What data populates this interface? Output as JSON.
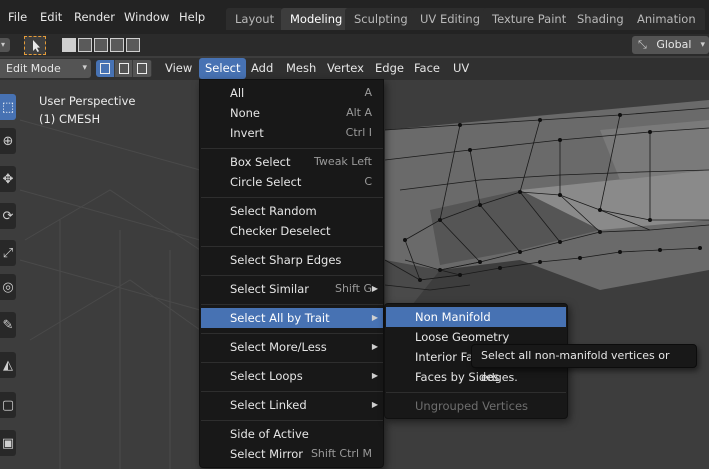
{
  "topbar": {
    "menus": [
      "File",
      "Edit",
      "Render",
      "Window",
      "Help"
    ],
    "workspaces": [
      "Layout",
      "Modeling",
      "Sculpting",
      "UV Editing",
      "Texture Paint",
      "Shading",
      "Animation"
    ],
    "active_workspace": "Modeling"
  },
  "toolrow": {
    "transform_orientation": "Global"
  },
  "header2": {
    "mode": "Edit Mode",
    "menus": [
      "View",
      "Select",
      "Add",
      "Mesh",
      "Vertex",
      "Edge",
      "Face",
      "UV"
    ],
    "active_menu": "Select"
  },
  "viewport": {
    "perspective": "User Perspective",
    "object": "(1) CMESH"
  },
  "select_menu": {
    "items": [
      {
        "label": "All",
        "shortcut": "A"
      },
      {
        "label": "None",
        "shortcut": "Alt A"
      },
      {
        "label": "Invert",
        "shortcut": "Ctrl I"
      },
      {
        "label": "Box Select",
        "shortcut": "Tweak Left"
      },
      {
        "label": "Circle Select",
        "shortcut": "C"
      },
      {
        "label": "Select Random",
        "shortcut": ""
      },
      {
        "label": "Checker Deselect",
        "shortcut": ""
      },
      {
        "label": "Select Sharp Edges",
        "shortcut": ""
      },
      {
        "label": "Select Similar",
        "shortcut": "Shift G"
      },
      {
        "label": "Select All by Trait",
        "shortcut": ""
      },
      {
        "label": "Select More/Less",
        "shortcut": ""
      },
      {
        "label": "Select Loops",
        "shortcut": ""
      },
      {
        "label": "Select Linked",
        "shortcut": ""
      },
      {
        "label": "Side of Active",
        "shortcut": ""
      },
      {
        "label": "Select Mirror",
        "shortcut": "Shift Ctrl M"
      }
    ],
    "highlighted": "Select All by Trait"
  },
  "trait_submenu": {
    "items": [
      "Non Manifold",
      "Loose Geometry",
      "Interior Fa",
      "Faces by Sides",
      "Ungrouped Vertices"
    ],
    "highlighted": "Non Manifold",
    "disabled": "Ungrouped Vertices"
  },
  "tooltip": {
    "text": "Select all non-manifold vertices or edges."
  },
  "icons": {
    "dropdown_chevron": "chevron-down-icon",
    "submenu_arrow": "chevron-right-icon",
    "orientation": "transform-orientation-icon"
  },
  "colors": {
    "accent": "#4772b3",
    "menu_bg": "#181818",
    "topbar_bg": "#232323",
    "viewport_bg": "#3d3d3d"
  }
}
